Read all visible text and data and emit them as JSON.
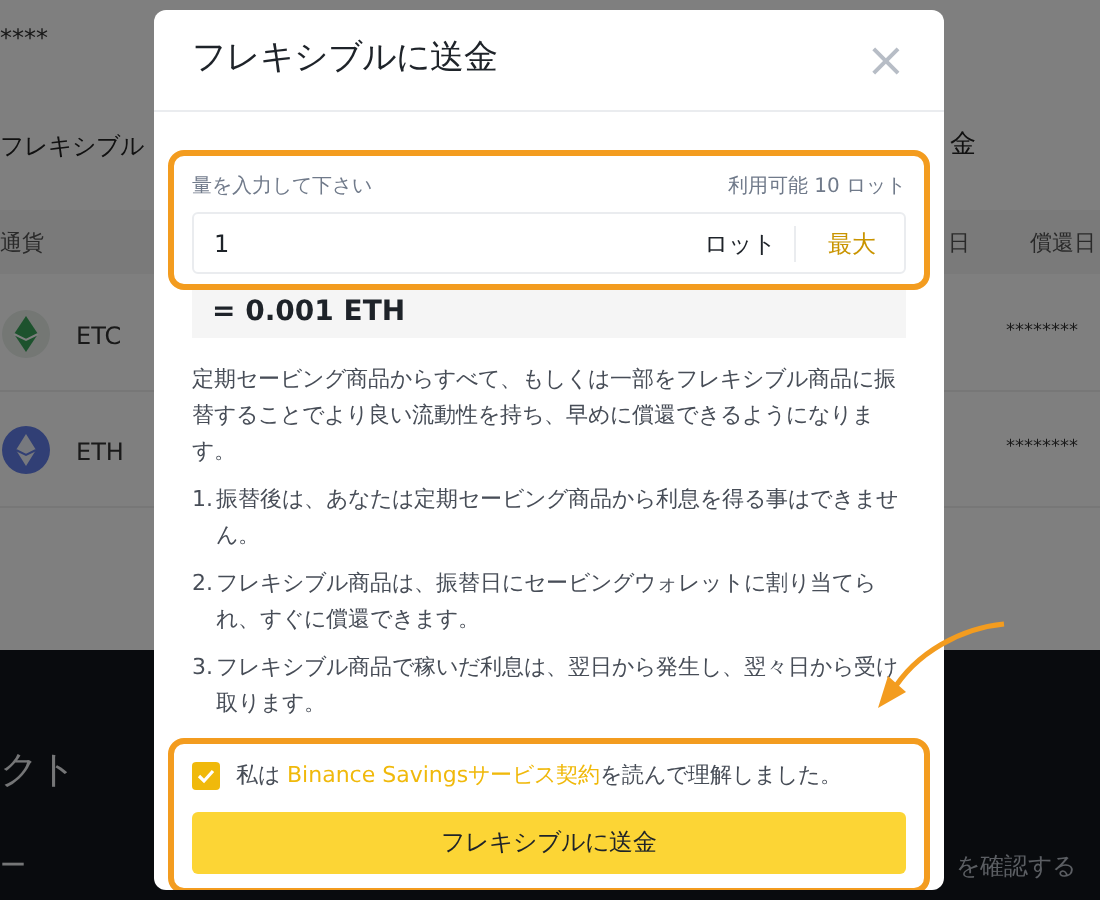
{
  "background_page": {
    "masked_value": "****",
    "tab_label": "フレキシブル",
    "right_label": "金",
    "columns": [
      {
        "label": "通貨"
      },
      {
        "label": "日"
      },
      {
        "label": "償還日"
      }
    ],
    "rows": [
      {
        "coin": "ETC",
        "kind": "etc",
        "column_4": "********"
      },
      {
        "coin": "ETH",
        "kind": "eth",
        "column_4": "********"
      }
    ],
    "footer_heading": "クト",
    "footer_mark": "ー",
    "footer_link": "を確認する"
  },
  "dialog": {
    "title": "フレキシブルに送金",
    "close": "×",
    "amount": {
      "label": "量を入力して下さい",
      "available": "利用可能 10 ロット",
      "value": "1",
      "unit": "ロット",
      "max": "最大"
    },
    "conversion": "= 0.001 ETH",
    "intro": "定期セービング商品からすべて、もしくは一部をフレキシブル商品に振替することでより良い流動性を持ち、早めに償還できるようになります。",
    "notes": [
      {
        "number": "1.",
        "text": "振替後は、あなたは定期セービング商品から利息を得る事はできません。"
      },
      {
        "number": "2.",
        "text": "フレキシブル商品は、振替日にセービングウォレットに割り当てられ、すぐに償還できます。"
      },
      {
        "number": "3.",
        "text": "フレキシブル商品で稼いだ利息は、翌日から発生し、翌々日から受け取ります。"
      }
    ],
    "agreement": {
      "checked": true,
      "prefix": "私は ",
      "link": "Binance Savingsサービス契約",
      "suffix": "を読んで理解しました。"
    },
    "submit": "フレキシブルに送金"
  }
}
